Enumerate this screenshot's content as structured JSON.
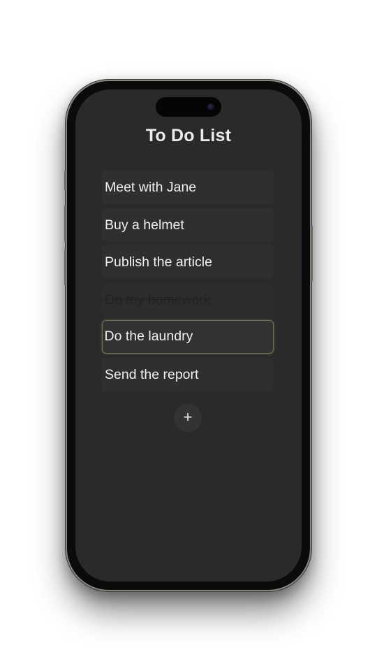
{
  "app": {
    "title": "To Do List"
  },
  "tasks": [
    {
      "label": "Meet with Jane",
      "done": false
    },
    {
      "label": "Buy a helmet",
      "done": false
    },
    {
      "label": "Publish the article",
      "done": false
    },
    {
      "label": "Do my homework",
      "done": true
    },
    {
      "label": "Do the laundry",
      "done": false,
      "focused": true
    },
    {
      "label": "Send the report",
      "done": false
    }
  ],
  "add_button": {
    "label": "+"
  },
  "colors": {
    "screen_background": "#2a2a2a",
    "item_background": "#2f2f2f",
    "focus_border": "#6b7858",
    "text": "#f0f0f0"
  }
}
